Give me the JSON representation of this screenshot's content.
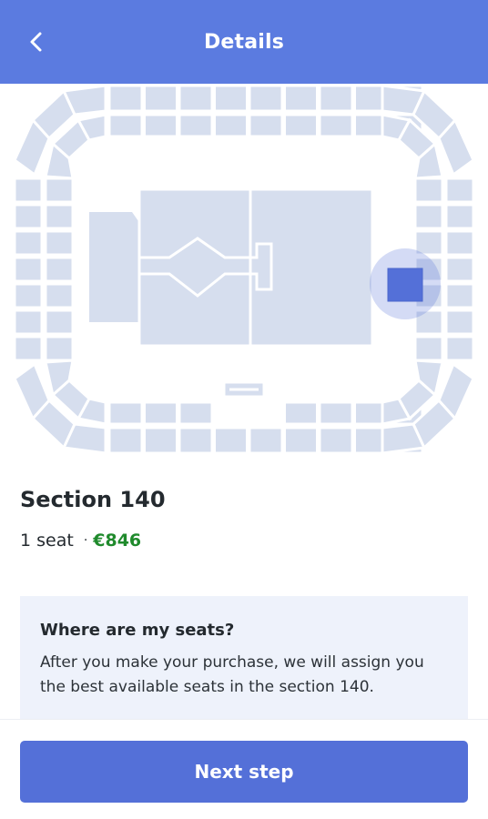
{
  "header": {
    "title": "Details",
    "back_icon": "chevron-left-icon"
  },
  "colors": {
    "header_bg": "#5b7be0",
    "section_fill": "#d6deee",
    "selected_section": "#5470d8",
    "price_green": "#1f8a2c",
    "button_bg": "#5470d8",
    "info_bg": "#eef2fb"
  },
  "section": {
    "title": "Section 140",
    "seats": "1 seat",
    "separator": "·",
    "price": "€846"
  },
  "info": {
    "title": "Where are my seats?",
    "text": "After you make your purchase, we will assign you the best available seats in the section 140."
  },
  "footer": {
    "next_label": "Next step"
  }
}
